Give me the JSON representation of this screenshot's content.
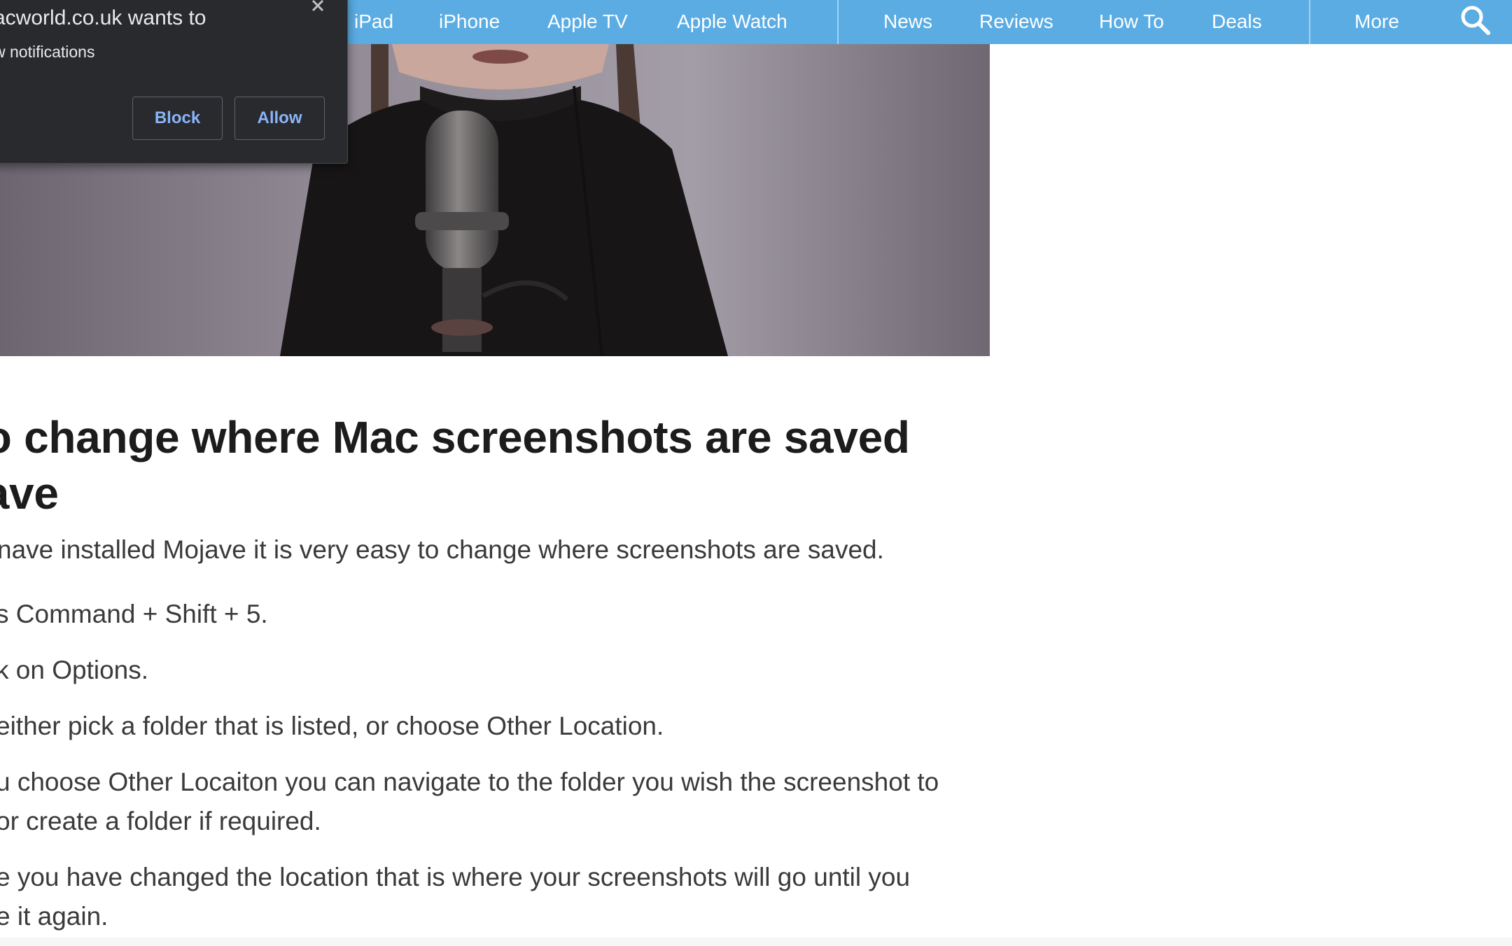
{
  "nav": {
    "items": [
      {
        "label": "iPad"
      },
      {
        "label": "iPhone"
      },
      {
        "label": "Apple TV"
      },
      {
        "label": "Apple Watch"
      },
      {
        "label": "News"
      },
      {
        "label": "Reviews"
      },
      {
        "label": "How To"
      },
      {
        "label": "Deals"
      },
      {
        "label": "More"
      }
    ],
    "search_icon": "search-icon",
    "background_color": "#5aace3"
  },
  "notification_popup": {
    "title": "acworld.co.uk wants to",
    "subtitle": "w notifications",
    "block_label": "Block",
    "allow_label": "Allow",
    "close_icon": "close-icon"
  },
  "article": {
    "title_line1": "v to change where Mac screenshots are saved",
    "title_line2": "lojave",
    "paragraphs": [
      "nave installed Mojave it is very easy to change where screenshots are saved.",
      "s Command + Shift + 5.",
      "k on Options.",
      " either pick a folder that is listed, or choose Other Location.",
      "u choose Other Locaiton you can navigate to the folder you wish the screenshot to",
      "or create a folder if required.",
      "e you have changed the location that is where your screenshots will go until you",
      "e it again."
    ]
  }
}
